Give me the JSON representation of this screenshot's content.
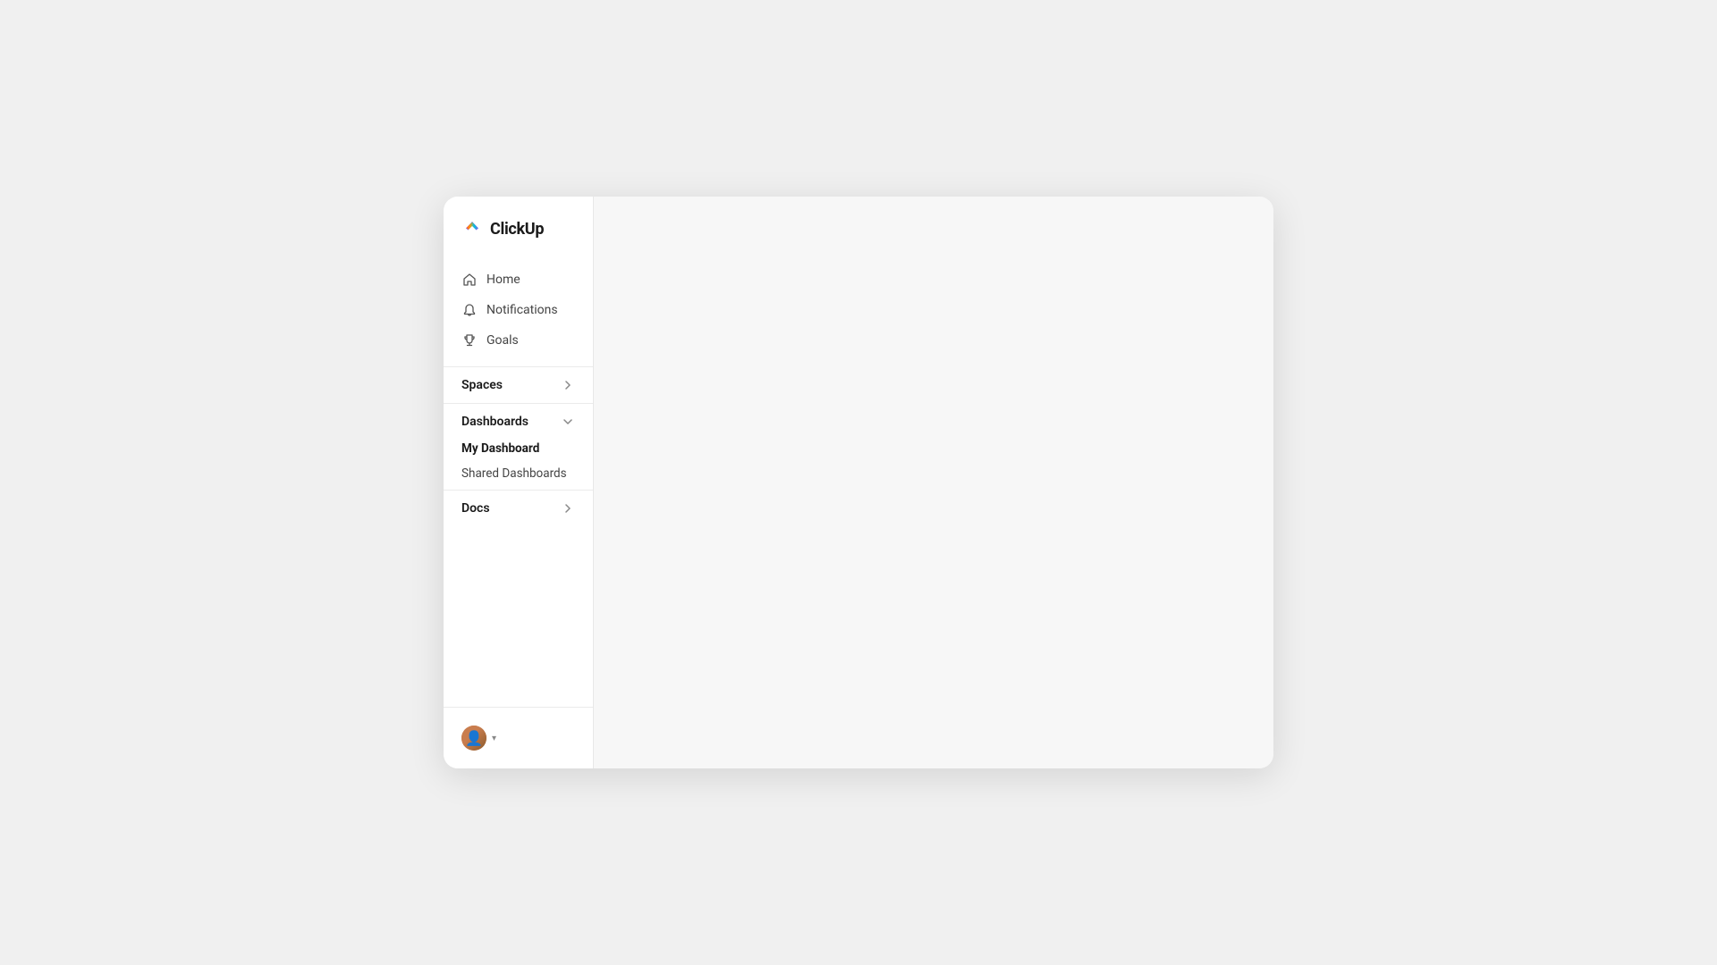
{
  "app": {
    "name": "ClickUp"
  },
  "sidebar": {
    "nav_items": [
      {
        "id": "home",
        "label": "Home",
        "icon": "home-icon"
      },
      {
        "id": "notifications",
        "label": "Notifications",
        "icon": "bell-icon"
      },
      {
        "id": "goals",
        "label": "Goals",
        "icon": "target-icon"
      }
    ],
    "sections": [
      {
        "id": "spaces",
        "label": "Spaces",
        "expanded": false,
        "icon": "chevron-right-icon",
        "children": []
      },
      {
        "id": "dashboards",
        "label": "Dashboards",
        "expanded": true,
        "icon": "chevron-down-icon",
        "children": [
          {
            "id": "my-dashboard",
            "label": "My Dashboard",
            "active": true
          },
          {
            "id": "shared-dashboards",
            "label": "Shared Dashboards",
            "active": false
          }
        ]
      },
      {
        "id": "docs",
        "label": "Docs",
        "expanded": false,
        "icon": "chevron-right-icon",
        "children": []
      }
    ],
    "user": {
      "chevron": "▾"
    }
  }
}
